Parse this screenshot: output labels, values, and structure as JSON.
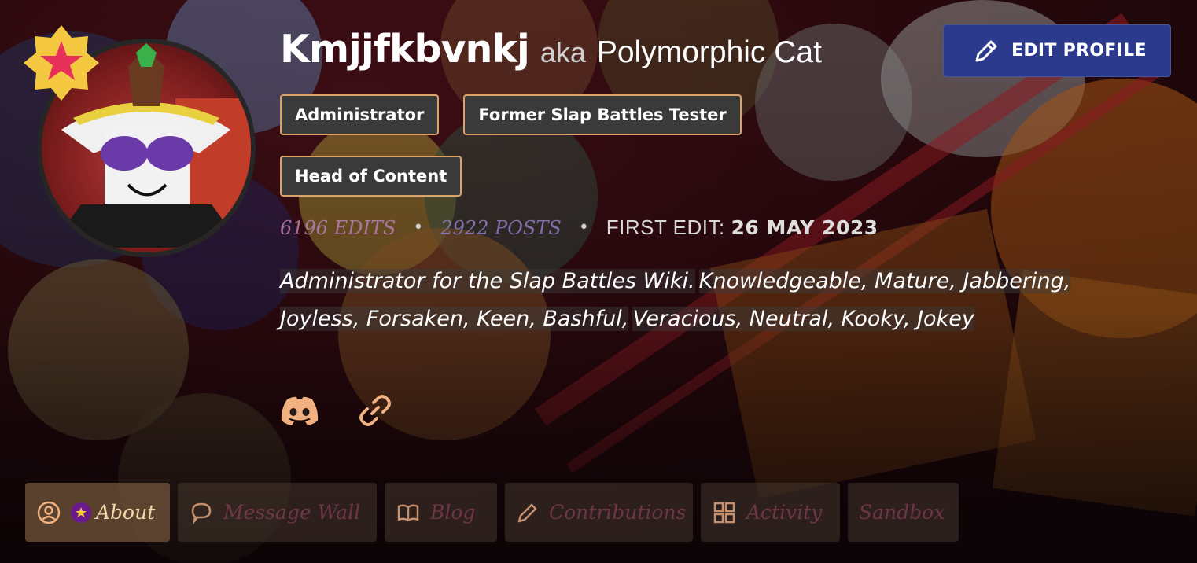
{
  "profile": {
    "username": "Kmjjfkbvnkj",
    "aka_label": "aka",
    "alias": "Polymorphic Cat",
    "edit_button_label": "EDIT PROFILE",
    "tags": [
      "Administrator",
      "Former Slap Battles Tester",
      "Head of Content"
    ],
    "stats": {
      "edits": "6196 EDITS",
      "posts": "2922 POSTS",
      "separator": "•",
      "first_edit_label": "FIRST EDIT:",
      "first_edit_date": "26 MAY 2023"
    },
    "bio_lines": [
      "Administrator for the Slap Battles Wiki.",
      "Knowledgeable, Mature, Jabbering, Joyless, Forsaken, Keen, Bashful,",
      "Veracious, Neutral, Kooky, Jokey"
    ],
    "social": [
      {
        "icon": "discord-icon"
      },
      {
        "icon": "link-icon"
      }
    ]
  },
  "tabs": [
    {
      "label": "About",
      "icon": "user-circle-icon",
      "active": true
    },
    {
      "label": "Message Wall",
      "icon": "speech-bubble-icon",
      "active": false
    },
    {
      "label": "Blog",
      "icon": "book-icon",
      "active": false
    },
    {
      "label": "Contributions",
      "icon": "pencil-icon",
      "active": false
    },
    {
      "label": "Activity",
      "icon": "grid-icon",
      "active": false
    },
    {
      "label": "Sandbox",
      "icon": "",
      "active": false
    }
  ],
  "colors": {
    "accent_border": "#d9a36a",
    "edit_button": "#2b3a8c",
    "badge_star": "#f5c842",
    "badge_star_inner": "#e8315a"
  }
}
